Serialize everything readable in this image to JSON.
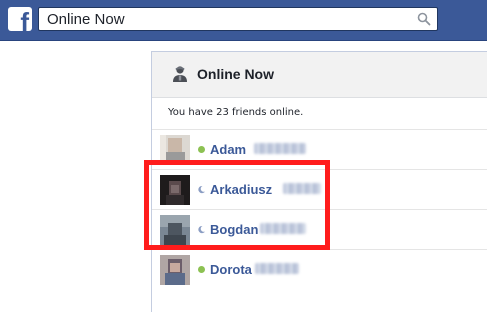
{
  "topbar": {
    "logo_icon": "facebook-logo-icon",
    "logo_letter": "f",
    "search_value": "Online Now",
    "search_icon": "search-icon",
    "bg_color": "#3b5998"
  },
  "panel": {
    "header_icon": "person-icon",
    "title": "Online Now",
    "summary": "You have 23 friends online."
  },
  "friends": [
    {
      "first_name": "Adam",
      "status": "online",
      "status_icon": "online-dot-icon"
    },
    {
      "first_name": "Arkadiusz",
      "status": "idle",
      "status_icon": "idle-moon-icon"
    },
    {
      "first_name": "Bogdan",
      "status": "idle",
      "status_icon": "idle-moon-icon"
    },
    {
      "first_name": "Dorota",
      "status": "online",
      "status_icon": "online-dot-icon"
    }
  ],
  "colors": {
    "online": "#8cc152",
    "link": "#3b5998",
    "highlight": "#ff1c1c"
  }
}
